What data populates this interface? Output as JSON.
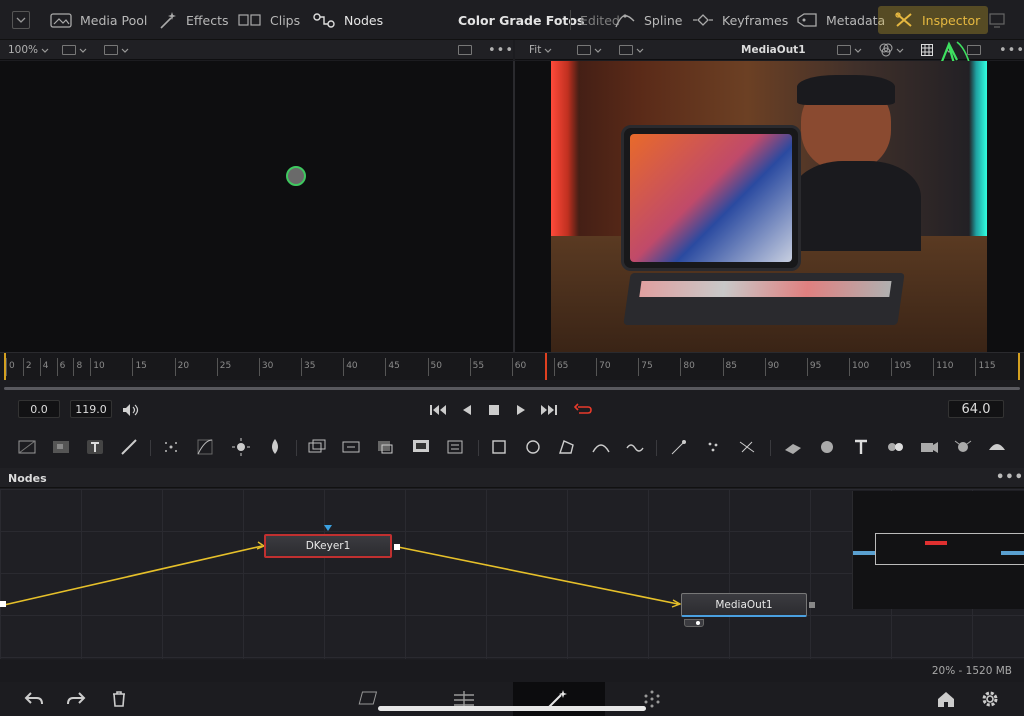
{
  "topbar": {
    "media_pool": "Media Pool",
    "effects": "Effects",
    "clips": "Clips",
    "nodes": "Nodes",
    "project_title": "Color Grade Fotos",
    "edited": "Edited",
    "spline": "Spline",
    "keyframes": "Keyframes",
    "metadata": "Metadata",
    "inspector": "Inspector"
  },
  "viewer_left": {
    "zoom": "100%"
  },
  "viewer_right": {
    "fit": "Fit",
    "name": "MediaOut1"
  },
  "ruler": {
    "labels": [
      "0",
      "2",
      "4",
      "6",
      "8",
      "10",
      "15",
      "20",
      "25",
      "30",
      "35",
      "40",
      "45",
      "50",
      "55",
      "60",
      "65",
      "70",
      "75",
      "80",
      "85",
      "90",
      "95",
      "100",
      "105",
      "110",
      "115"
    ]
  },
  "transport": {
    "start": "0.0",
    "end": "119.0",
    "current": "64.0"
  },
  "nodes_panel": {
    "title": "Nodes",
    "dkeyer": "DKeyer1",
    "mediaout": "MediaOut1",
    "status": "20% - 1520 MB"
  },
  "colors": {
    "accent": "#e6b840",
    "connection": "#e6c02a",
    "selected_outline": "#c03030",
    "playhead": "#e04020",
    "loop": "#e83a2a"
  }
}
